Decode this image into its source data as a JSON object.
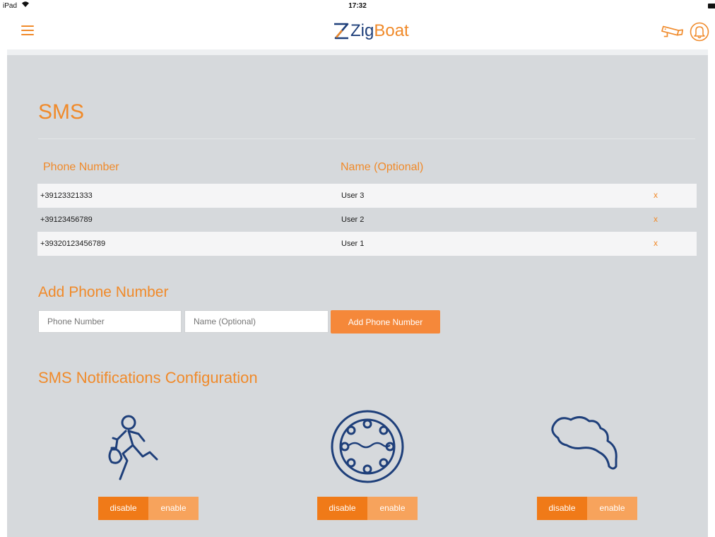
{
  "status_bar": {
    "device": "iPad",
    "time": "17:32"
  },
  "header": {
    "logo_text_part1": "Zig",
    "logo_text_part2": "Boat",
    "icons": [
      "menu-icon",
      "camera-icon",
      "bell-icon"
    ]
  },
  "colors": {
    "accent": "#f08a2a",
    "brand_blue": "#1e3f7a",
    "panel_bg": "#d6d9dc",
    "button_dark": "#f07a18",
    "button_light": "#f7a35c"
  },
  "sms": {
    "title": "SMS",
    "columns": {
      "phone": "Phone Number",
      "name": "Name (Optional)"
    },
    "rows": [
      {
        "phone": "+39123321333",
        "name": "User 3",
        "delete": "x"
      },
      {
        "phone": "+39123456789",
        "name": "User 2",
        "delete": "x"
      },
      {
        "phone": "+39320123456789",
        "name": "User 1",
        "delete": "x"
      }
    ]
  },
  "add": {
    "title": "Add Phone Number",
    "phone_placeholder": "Phone Number",
    "name_placeholder": "Name (Optional)",
    "button_label": "Add Phone Number"
  },
  "config": {
    "title": "SMS Notifications Configuration",
    "notifications": [
      {
        "icon": "intruder-icon",
        "disable_label": "disable",
        "enable_label": "enable"
      },
      {
        "icon": "porthole-water-icon",
        "disable_label": "disable",
        "enable_label": "enable"
      },
      {
        "icon": "smoke-icon",
        "disable_label": "disable",
        "enable_label": "enable"
      }
    ]
  }
}
